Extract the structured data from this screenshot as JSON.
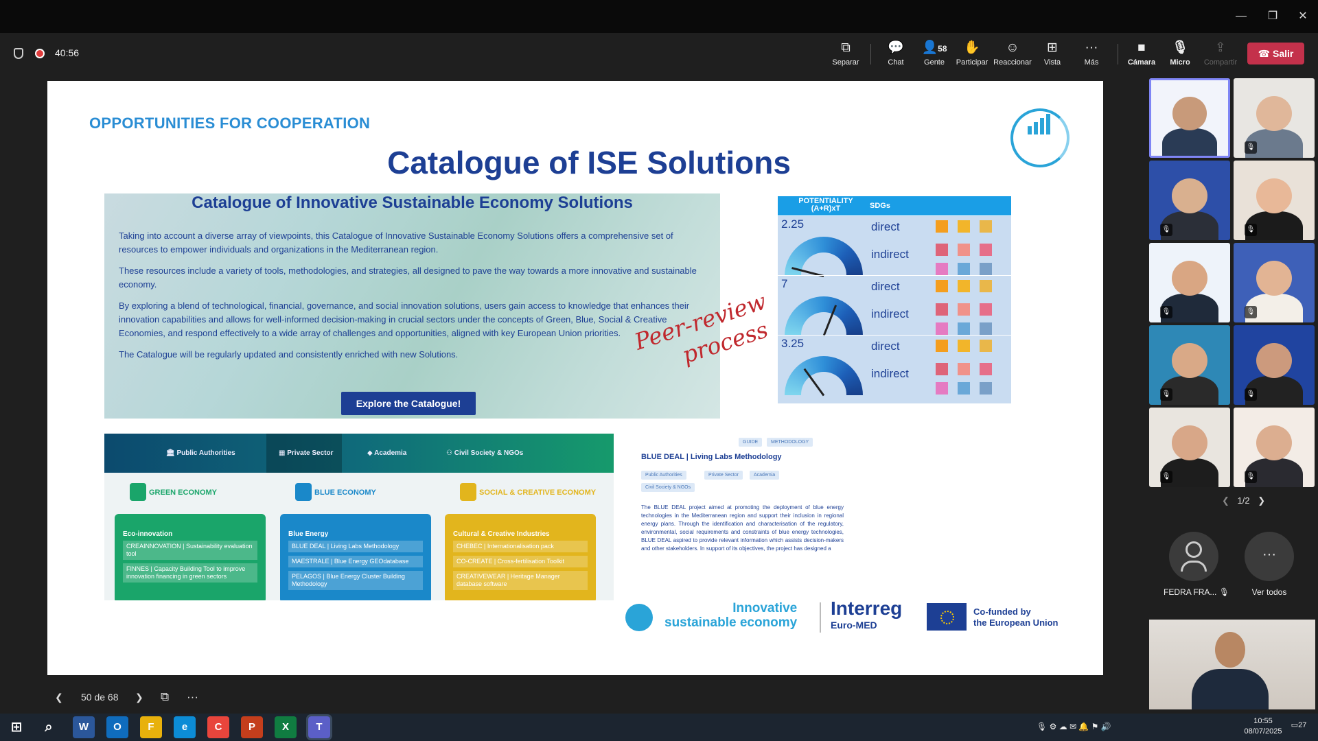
{
  "window": {
    "controls": [
      "minimize",
      "restore",
      "close"
    ]
  },
  "toolbar": {
    "timer": "40:56",
    "buttons": {
      "separar": "Separar",
      "chat": "Chat",
      "gente": "Gente",
      "gente_count": "58",
      "participar": "Participar",
      "reaccionar": "Reaccionar",
      "vista": "Vista",
      "mas": "Más",
      "camara": "Cámara",
      "micro": "Micro",
      "compartir": "Compartir"
    },
    "leave": "Salir",
    "leave_color": "#c4314b"
  },
  "slide": {
    "eyebrow": "OPPORTUNITIES FOR COOPERATION",
    "title": "Catalogue of ISE Solutions",
    "catalogue": {
      "heading": "Catalogue of Innovative Sustainable Economy Solutions",
      "paragraphs": [
        "Taking into account a diverse array of viewpoints, this Catalogue of Innovative Sustainable Economy Solutions offers a comprehensive set of resources to empower individuals and organizations in the Mediterranean region.",
        "These resources include a variety of tools, methodologies, and strategies, all designed to pave the way towards a more innovative and sustainable economy.",
        "By exploring a blend of technological, financial, governance, and social innovation solutions, users gain access to knowledge that enhances their innovation capabilities and allows for well-informed decision-making in crucial sectors under the concepts of Green, Blue, Social & Creative Economies, and respond effectively to a wide array of challenges and opportunities, aligned with key European Union priorities.",
        "The Catalogue will be regularly updated and consistently enriched with new Solutions."
      ],
      "button": "Explore the Catalogue!"
    },
    "sdg": {
      "col1": "POTENTIALITY (A+R)xT",
      "col2": "SDGs",
      "rows": [
        {
          "score": "2.25",
          "direct": "direct",
          "indirect": "indirect",
          "needle": 0.08
        },
        {
          "score": "7",
          "direct": "direct",
          "indirect": "indirect",
          "needle": 0.62
        },
        {
          "score": "3.25",
          "direct": "direct",
          "indirect": "indirect",
          "needle": 0.3
        }
      ]
    },
    "peer_review": [
      "Peer-review",
      "process"
    ],
    "sectors": {
      "tabs": [
        "Public Authorities",
        "Private Sector",
        "Academia",
        "Civil Society & NGOs"
      ],
      "economies": [
        {
          "title": "GREEN ECONOMY",
          "color": "#1aa56a",
          "category": "Eco-innovation",
          "items": [
            "CREAINNOVATION | Sustainability evaluation tool",
            "FINNES | Capacity Building Tool to improve innovation financing in green sectors"
          ]
        },
        {
          "title": "BLUE ECONOMY",
          "color": "#1a88c9",
          "category": "Blue Energy",
          "items": [
            "BLUE DEAL | Living Labs Methodology",
            "MAESTRALE | Blue Energy GEOdatabase",
            "PELAGOS | Blue Energy Cluster Building Methodology"
          ]
        },
        {
          "title": "SOCIAL & CREATIVE ECONOMY",
          "color": "#e2b51d",
          "category": "Cultural & Creative Industries",
          "items": [
            "CHEBEC | Internationalisation pack",
            "CO-CREATE | Cross-fertilisation Toolkit",
            "CREATIVEWEAR | Heritage Manager database software"
          ]
        }
      ]
    },
    "blue_deal": {
      "tags_top": [
        "GUIDE",
        "METHODOLOGY"
      ],
      "title": "BLUE DEAL | Living Labs Methodology",
      "tags": [
        "Public Authorities",
        "Private Sector",
        "Academia",
        "Civil Society & NGOs"
      ],
      "text": "The BLUE DEAL project aimed at promoting the deployment of blue energy technologies in the Mediterranean region and support their inclusion in regional energy plans. Through the identification and characterisation of the regulatory, environmental, social requirements and constraints of blue energy technologies, BLUE DEAL aspired to provide relevant information which assists decision-makers and other stakeholders. In support of its objectives, the project has designed a"
    },
    "footer": {
      "ise_line1": "Innovative",
      "ise_line2": "sustainable economy",
      "interreg": "Interreg",
      "euromed": "Euro-MED",
      "eu_line1": "Co-funded by",
      "eu_line2": "the European Union"
    }
  },
  "slide_nav": {
    "position": "50 de 68"
  },
  "gallery": {
    "pager": "1/2",
    "participant_name": "FEDRA FRA...",
    "see_all": "Ver todos"
  },
  "taskbar": {
    "time": "10:55",
    "date": "08/07/2025",
    "notifications": "27",
    "apps": [
      "W",
      "O",
      "F",
      "e",
      "C",
      "P",
      "X",
      "T"
    ]
  }
}
